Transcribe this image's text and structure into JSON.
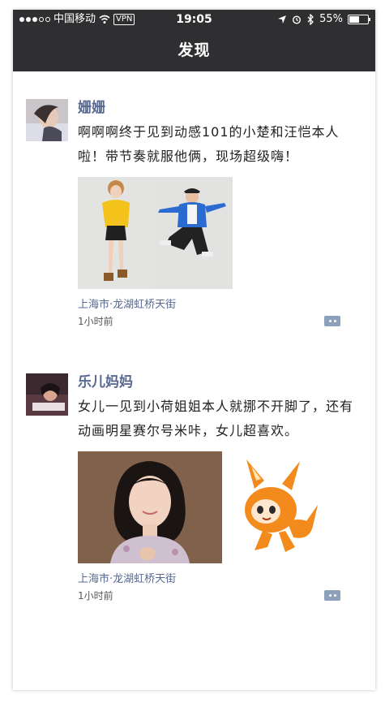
{
  "status_bar": {
    "carrier": "中国移动",
    "vpn": "VPN",
    "time": "19:05",
    "battery": "55%",
    "battery_level": 0.55
  },
  "nav": {
    "title": "发现"
  },
  "posts": [
    {
      "name": "姗姗",
      "content": "啊啊啊终于见到动感101的小楚和汪恺本人啦！带节奏就服他俩，现场超级嗨！",
      "location": "上海市·龙湖虹桥天街",
      "time": "1小时前"
    },
    {
      "name": "乐儿妈妈",
      "content": "女儿一见到小荷姐姐本人就挪不开脚了，还有动画明星赛尔号米咔，女儿超喜欢。",
      "location": "上海市·龙湖虹桥天街",
      "time": "1小时前"
    }
  ],
  "colors": {
    "bar": "#2f2f31",
    "link": "#58688f",
    "comment_icon": "#8ca0bb"
  }
}
